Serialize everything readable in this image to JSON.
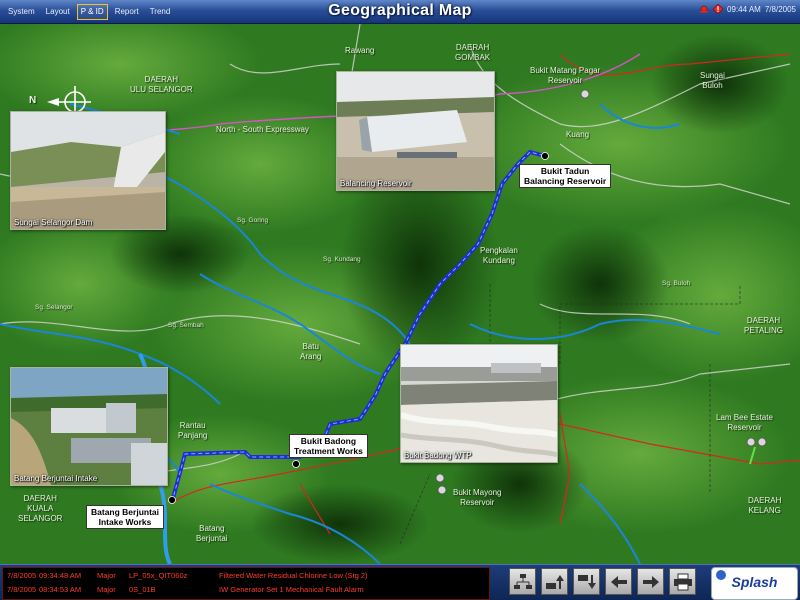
{
  "header": {
    "menu": [
      "System",
      "Layout",
      "P & ID",
      "Report",
      "Trend"
    ],
    "active_menu": "P & ID",
    "title": "Geographical Map",
    "time": "09:44 AM",
    "date": "7/8/2005"
  },
  "map": {
    "compass_label": "N",
    "areas": {
      "ulu_selangor": "DAERAH\nULU SELANGOR",
      "gombak": "DAERAH\nGOMBAK",
      "petaling": "DAERAH\nPETALING",
      "kuala_selangor": "DAERAH\nKUALA\nSELANGOR",
      "kelang": "DAERAH\nKELANG"
    },
    "places": {
      "rawang": "Rawang",
      "kuang": "Kuang",
      "sungai_buloh": "Sungai\nBuloh",
      "pengkalan_kundang": "Pengkalan\nKundang",
      "batu_arang": "Batu\nArang",
      "rantau_panjang": "Rantau\nPanjang",
      "batang_berjuntai": "Batang\nBerjuntai",
      "expressway": "North - South Expressway"
    },
    "rivers": {
      "goring": "Sg. Goring",
      "kundang": "Sg. Kundang",
      "selangor": "Sg. Selangor",
      "sembah": "Sg. Sembah",
      "buloh": "Sg. Buloh"
    },
    "reservoirs": {
      "bukit_matang_pagar": "Bukit Matang Pagar\nReservoir",
      "lam_bee_estate": "Lam Bee Estate\nReservoir",
      "bukit_mayong": "Bukit Mayong\nReservoir"
    },
    "stations": {
      "bukit_tadun": "Bukit Tadun\nBalancing Reservoir",
      "bukit_badong": "Bukit Badong\nTreatment Works",
      "batang_berjuntai_intake": "Batang Berjuntai\nIntake Works"
    },
    "photos": {
      "dam": "Sungai Selangor Dam",
      "balancing": "Balancing Reservoir",
      "intake": "Batang Berjuntai Intake",
      "wtp": "Bukit Badong WTP"
    }
  },
  "alarms": [
    {
      "date": "7/8/2005",
      "time": "09:34:48 AM",
      "priority": "Major",
      "tag": "LP_05x_QIT060z",
      "desc": "Filtered Water Residual Chlorine Low (Stg 2)"
    },
    {
      "date": "7/8/2005",
      "time": "08:34:53 AM",
      "priority": "Major",
      "tag": "0S_01B",
      "desc": "IW Generator Set 1 Mechanical Fault Alarm"
    }
  ],
  "toolbar": {
    "buttons": [
      "overview-button",
      "trend-up-button",
      "trend-down-button",
      "back-button",
      "forward-button",
      "print-button"
    ],
    "brand": "Splash"
  },
  "colors": {
    "pipeline": "#1a2fd6",
    "river": "#1a86d8",
    "road": "#d4d4d4",
    "boundary_red": "#d8261e",
    "expressway": "#d653c9",
    "terrain": "#2f7a21"
  }
}
